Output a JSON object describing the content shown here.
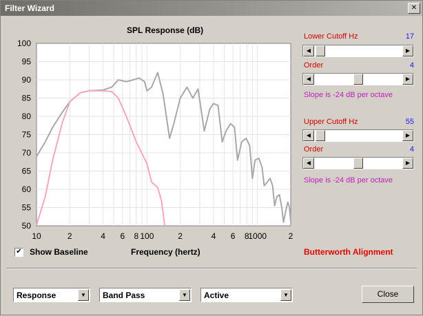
{
  "window": {
    "title": "Filter Wizard",
    "close_glyph": "✕"
  },
  "chart_data": {
    "type": "line",
    "title": "SPL Response (dB)",
    "xlabel": "Frequency (hertz)",
    "ylabel": "",
    "x_scale": "log",
    "xlim": [
      10,
      2000
    ],
    "ylim": [
      50,
      100
    ],
    "y_ticks": [
      50,
      55,
      60,
      65,
      70,
      75,
      80,
      85,
      90,
      95,
      100
    ],
    "x_tick_labels": [
      {
        "v": 10,
        "t": "10"
      },
      {
        "v": 20,
        "t": "2"
      },
      {
        "v": 40,
        "t": "4"
      },
      {
        "v": 60,
        "t": "6"
      },
      {
        "v": 80,
        "t": "8"
      },
      {
        "v": 100,
        "t": "100"
      },
      {
        "v": 200,
        "t": "2"
      },
      {
        "v": 400,
        "t": "4"
      },
      {
        "v": 600,
        "t": "6"
      },
      {
        "v": 800,
        "t": "8"
      },
      {
        "v": 1000,
        "t": "1000"
      },
      {
        "v": 2000,
        "t": "2"
      }
    ],
    "grid": true,
    "series": [
      {
        "color": "#a8a8a8",
        "points": [
          [
            10,
            69
          ],
          [
            12,
            73
          ],
          [
            14,
            77
          ],
          [
            17,
            81
          ],
          [
            20,
            84
          ],
          [
            25,
            86.5
          ],
          [
            30,
            87
          ],
          [
            40,
            87.2
          ],
          [
            48,
            88
          ],
          [
            55,
            90
          ],
          [
            65,
            89.5
          ],
          [
            75,
            90
          ],
          [
            85,
            90.5
          ],
          [
            95,
            89.5
          ],
          [
            100,
            87
          ],
          [
            110,
            88
          ],
          [
            125,
            92
          ],
          [
            140,
            86
          ],
          [
            160,
            74
          ],
          [
            175,
            78
          ],
          [
            200,
            85
          ],
          [
            230,
            88
          ],
          [
            260,
            85
          ],
          [
            290,
            87.5
          ],
          [
            330,
            76
          ],
          [
            370,
            82
          ],
          [
            400,
            83.5
          ],
          [
            440,
            83
          ],
          [
            480,
            73
          ],
          [
            520,
            76
          ],
          [
            570,
            78
          ],
          [
            620,
            77
          ],
          [
            660,
            68
          ],
          [
            720,
            73
          ],
          [
            790,
            74
          ],
          [
            850,
            72
          ],
          [
            900,
            63
          ],
          [
            950,
            68
          ],
          [
            1030,
            68.5
          ],
          [
            1100,
            66
          ],
          [
            1150,
            61
          ],
          [
            1230,
            62
          ],
          [
            1300,
            63
          ],
          [
            1370,
            61
          ],
          [
            1430,
            55.5
          ],
          [
            1500,
            58
          ],
          [
            1580,
            58.5
          ],
          [
            1660,
            55
          ],
          [
            1720,
            51
          ],
          [
            1800,
            54
          ],
          [
            1880,
            56.5
          ],
          [
            1950,
            55
          ],
          [
            2000,
            51
          ]
        ]
      },
      {
        "color": "#f4a8bc",
        "points": [
          [
            10,
            50.2
          ],
          [
            12,
            58
          ],
          [
            14,
            68
          ],
          [
            17,
            78
          ],
          [
            20,
            84
          ],
          [
            25,
            86.5
          ],
          [
            30,
            87
          ],
          [
            40,
            87
          ],
          [
            48,
            86.8
          ],
          [
            55,
            85
          ],
          [
            65,
            80
          ],
          [
            80,
            73
          ],
          [
            100,
            67
          ],
          [
            110,
            62
          ],
          [
            125,
            60.5
          ],
          [
            135,
            57
          ],
          [
            145,
            50
          ]
        ]
      }
    ]
  },
  "controls": {
    "show_baseline_label": "Show Baseline",
    "show_baseline_checked": true,
    "check_glyph": "✔",
    "alignment_label": "Butterworth Alignment",
    "lower_cutoff": {
      "label": "Lower Cutoff  Hz",
      "value": "17",
      "level": 0.02
    },
    "lower_order": {
      "label": "Order",
      "value": "4",
      "level": 0.5
    },
    "lower_slope": "Slope is -24 dB per octave",
    "upper_cutoff": {
      "label": "Upper Cutoff  Hz",
      "value": "55",
      "level": 0.02
    },
    "upper_order": {
      "label": "Order",
      "value": "4",
      "level": 0.5
    },
    "upper_slope": "Slope is -24 dB per octave",
    "arrow_left": "◀",
    "arrow_right": "▶",
    "arrow_down": "▼"
  },
  "bottom": {
    "mode": "Response",
    "filter_type": "Band Pass",
    "filter_kind": "Active",
    "close_label": "Close"
  }
}
